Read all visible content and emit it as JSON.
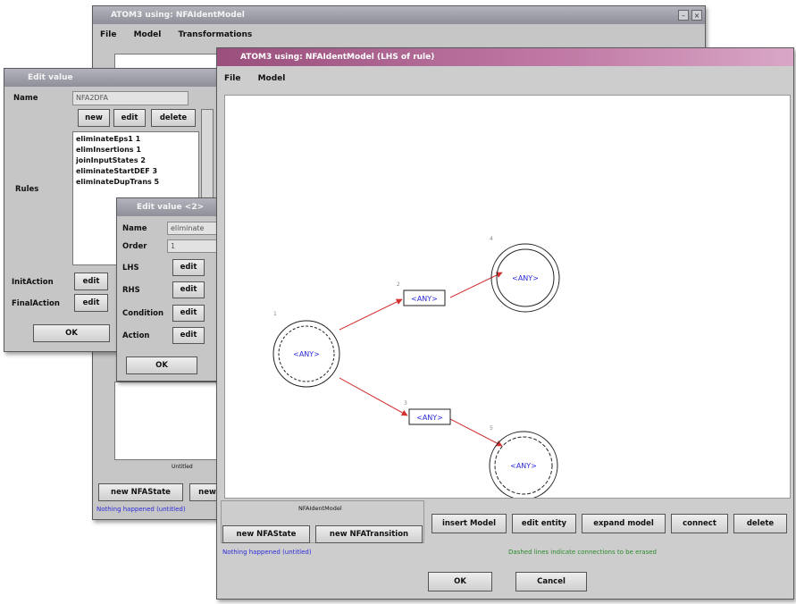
{
  "back_window": {
    "title": "ATOM3 using: NFAIdentModel",
    "menu": [
      "File",
      "Model",
      "Transformations"
    ],
    "status_bar_label": "Untitled",
    "buttons": [
      "new NFAState",
      "new"
    ],
    "status_text": "Nothing happened (untitled)"
  },
  "edit_value_window": {
    "title": "Edit value",
    "name_label": "Name",
    "name_value": "NFA2DFA",
    "rules_label": "Rules",
    "list_buttons": [
      "new",
      "edit",
      "delete"
    ],
    "rules": [
      "eliminateEps1 1",
      "elimInsertions 1",
      "joinInputStates 2",
      "eliminateStartDEF 3",
      "eliminateDupTrans 5"
    ],
    "init_action_label": "InitAction",
    "final_action_label": "FinalAction",
    "edit_label": "edit",
    "ok_label": "OK"
  },
  "edit_value_2_window": {
    "title": "Edit value <2>",
    "name_label": "Name",
    "name_value": "eliminate",
    "order_label": "Order",
    "order_value": "1",
    "rows": [
      {
        "label": "LHS",
        "button": "edit"
      },
      {
        "label": "RHS",
        "button": "edit"
      },
      {
        "label": "Condition",
        "button": "edit"
      },
      {
        "label": "Action",
        "button": "edit"
      }
    ],
    "ok_label": "OK"
  },
  "main_window": {
    "title": "ATOM3 using: NFAIdentModel (LHS of rule)",
    "menu": [
      "File",
      "Model"
    ],
    "canvas": {
      "nodes": [
        {
          "id": "s1",
          "label": "<ANY>",
          "kind": "state",
          "num": "1"
        },
        {
          "id": "s2",
          "label": "<ANY>",
          "kind": "state",
          "num": "4"
        },
        {
          "id": "s3",
          "label": "<ANY>",
          "kind": "state",
          "num": "5"
        },
        {
          "id": "t1",
          "label": "<ANY>",
          "kind": "transition",
          "num": "2"
        },
        {
          "id": "t2",
          "label": "<ANY>",
          "kind": "transition",
          "num": "3"
        }
      ]
    },
    "panel_label": "NFAIdentModel",
    "left_buttons": [
      "new NFAState",
      "new NFATransition"
    ],
    "right_buttons": [
      "insert Model",
      "edit entity",
      "expand model",
      "connect",
      "delete"
    ],
    "status_left": "Nothing happened (untitled)",
    "status_right": "Dashed lines indicate connections to be erased",
    "ok_label": "OK",
    "cancel_label": "Cancel"
  },
  "colors": {
    "accent_title": "#b0608f",
    "edge": "#d43030",
    "node_text": "#2b2bd8",
    "status_blue": "#2b2bd8",
    "status_green": "#2a8a2a"
  }
}
